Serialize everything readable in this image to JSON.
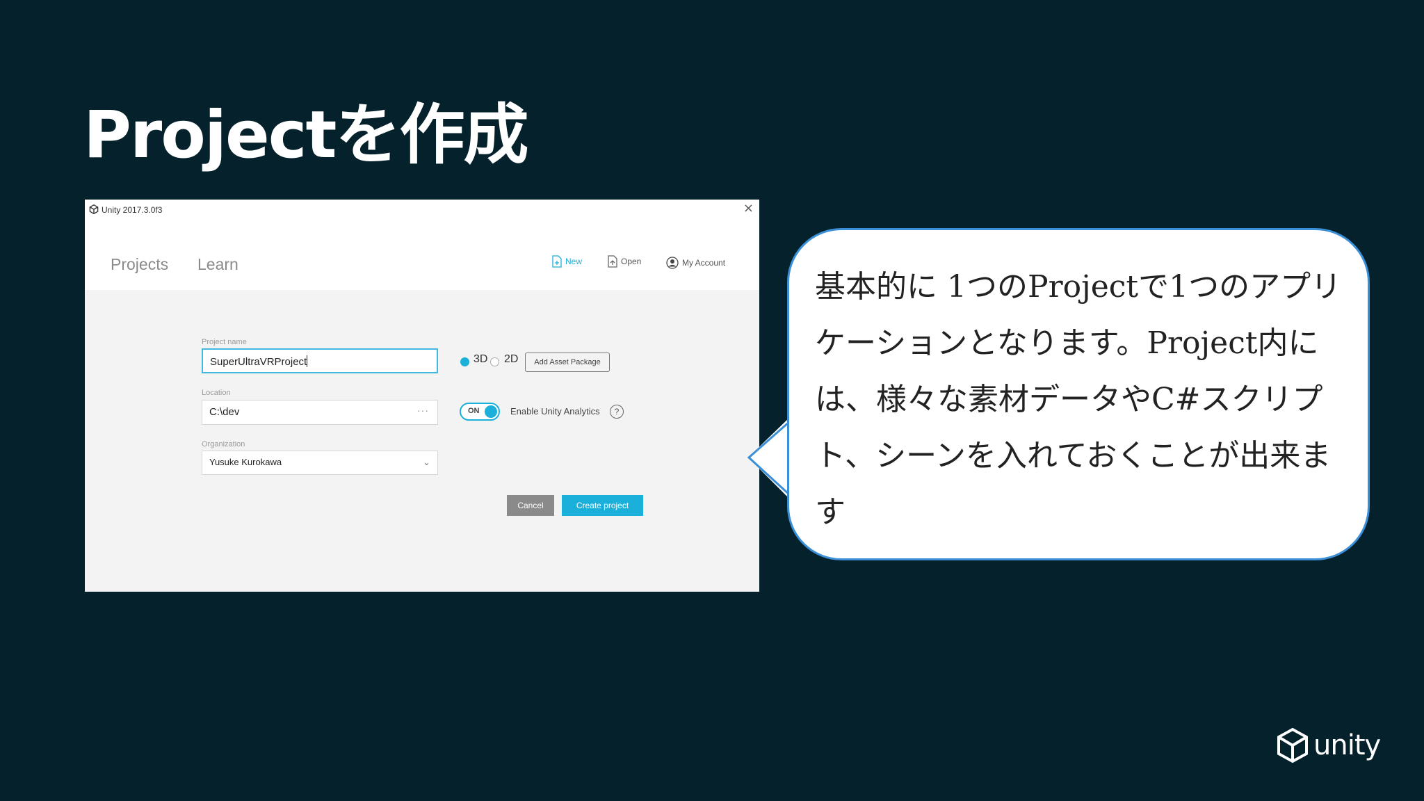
{
  "slide": {
    "title": "Projectを作成",
    "callout": "基本的に 1つのProjectで1つのアプリケーションとなります。Project内には、様々な素材データやC#スクリプト、シーンを入れておくことが出来ます",
    "logo_text": "unity"
  },
  "window": {
    "title": "Unity 2017.3.0f3",
    "close": "×",
    "tabs": [
      "Projects",
      "Learn"
    ],
    "actions": {
      "new": "New",
      "open": "Open",
      "account": "My Account"
    }
  },
  "form": {
    "project_name_label": "Project name",
    "project_name_value": "SuperUltraVRProject",
    "location_label": "Location",
    "location_value": "C:\\dev",
    "location_more": "···",
    "organization_label": "Organization",
    "organization_value": "Yusuke Kurokawa",
    "radio_3d": "3D",
    "radio_2d": "2D",
    "selected_mode": "3D",
    "add_asset_package": "Add Asset Package",
    "toggle_state": "ON",
    "analytics_label": "Enable Unity Analytics",
    "help": "?",
    "cancel": "Cancel",
    "create": "Create project"
  },
  "colors": {
    "accent": "#1ab0d9",
    "background": "#04212c",
    "bubble_border": "#3b8fd6"
  },
  "icons": [
    "unity-logo-icon",
    "close-icon",
    "new-file-icon",
    "open-file-icon",
    "account-icon",
    "more-icon",
    "chevron-down-icon",
    "help-icon"
  ]
}
